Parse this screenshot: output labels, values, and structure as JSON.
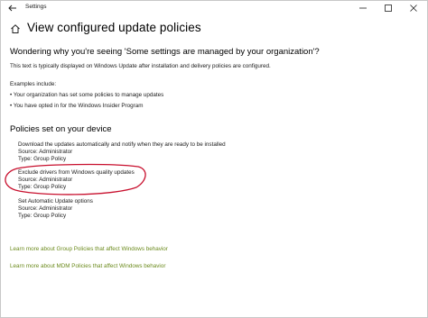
{
  "window": {
    "title": "Settings",
    "accent": "#6b8a1c"
  },
  "header": {
    "title": "View configured update policies"
  },
  "intro": {
    "heading": "Wondering why you're seeing 'Some settings are managed by your organization'?",
    "text": "This text is typically displayed on Windows Update after installation and delivery policies are configured.",
    "examples_label": "Examples include:",
    "examples": [
      "• Your organization has set some policies to manage updates",
      "• You have opted in for the Windows Insider Program"
    ]
  },
  "policies": {
    "heading": "Policies set on your device",
    "items": [
      {
        "name": "Download the updates automatically and notify when they are ready to be installed",
        "source": "Source: Administrator",
        "type": "Type: Group Policy"
      },
      {
        "name": "Exclude drivers from Windows quality updates",
        "source": "Source: Administrator",
        "type": "Type: Group Policy",
        "highlighted": true
      },
      {
        "name": "Set Automatic Update options",
        "source": "Source: Administrator",
        "type": "Type: Group Policy"
      }
    ]
  },
  "links": [
    "Learn more about Group Policies that affect Windows behavior",
    "Learn more about MDM Policies that affect Windows behavior"
  ],
  "annotation_color": "#c8102e"
}
